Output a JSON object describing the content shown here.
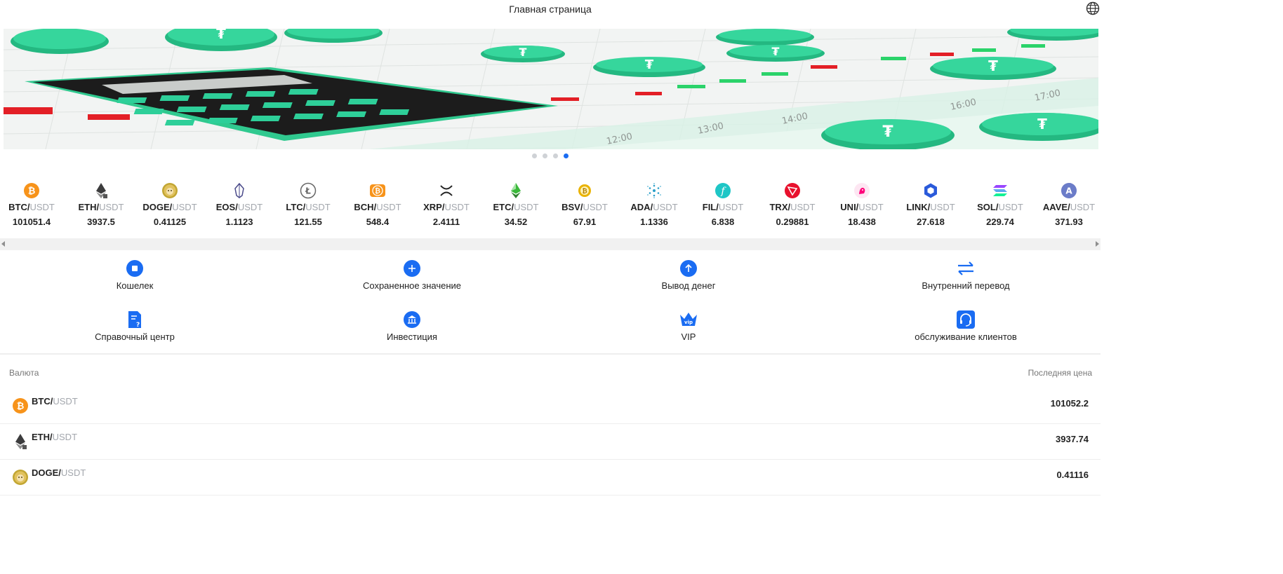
{
  "header": {
    "title": "Главная страница",
    "language_icon": "globe-icon"
  },
  "banner": {
    "slides": 4,
    "active_slide": 4
  },
  "ticker": [
    {
      "base": "BTC/",
      "quote": "USDT",
      "price": "101051.4",
      "icon": "btc-icon"
    },
    {
      "base": "ETH/",
      "quote": "USDT",
      "price": "3937.5",
      "icon": "eth-icon"
    },
    {
      "base": "DOGE/",
      "quote": "USDT",
      "price": "0.41125",
      "icon": "doge-icon"
    },
    {
      "base": "EOS/",
      "quote": "USDT",
      "price": "1.1123",
      "icon": "eos-icon"
    },
    {
      "base": "LTC/",
      "quote": "USDT",
      "price": "121.55",
      "icon": "ltc-icon"
    },
    {
      "base": "BCH/",
      "quote": "USDT",
      "price": "548.4",
      "icon": "bch-icon"
    },
    {
      "base": "XRP/",
      "quote": "USDT",
      "price": "2.4111",
      "icon": "xrp-icon"
    },
    {
      "base": "ETC/",
      "quote": "USDT",
      "price": "34.52",
      "icon": "etc-icon"
    },
    {
      "base": "BSV/",
      "quote": "USDT",
      "price": "67.91",
      "icon": "bsv-icon"
    },
    {
      "base": "ADA/",
      "quote": "USDT",
      "price": "1.1336",
      "icon": "ada-icon"
    },
    {
      "base": "FIL/",
      "quote": "USDT",
      "price": "6.838",
      "icon": "fil-icon"
    },
    {
      "base": "TRX/",
      "quote": "USDT",
      "price": "0.29881",
      "icon": "trx-icon"
    },
    {
      "base": "UNI/",
      "quote": "USDT",
      "price": "18.438",
      "icon": "uni-icon"
    },
    {
      "base": "LINK/",
      "quote": "USDT",
      "price": "27.618",
      "icon": "link-icon"
    },
    {
      "base": "SOL/",
      "quote": "USDT",
      "price": "229.74",
      "icon": "sol-icon"
    },
    {
      "base": "AAVE/",
      "quote": "USDT",
      "price": "371.93",
      "icon": "aave-icon"
    }
  ],
  "actions": [
    {
      "label": "Кошелек",
      "icon": "wallet-icon"
    },
    {
      "label": "Сохраненное значение",
      "icon": "plus-icon"
    },
    {
      "label": "Вывод денег",
      "icon": "withdraw-arrow-icon"
    },
    {
      "label": "Внутренний перевод",
      "icon": "transfer-arrows-icon"
    },
    {
      "label": "Справочный центр",
      "icon": "help-document-icon"
    },
    {
      "label": "Инвестиция",
      "icon": "bank-icon"
    },
    {
      "label": "VIP",
      "icon": "vip-crown-icon"
    },
    {
      "label": "обслуживание клиентов",
      "icon": "headset-icon"
    }
  ],
  "market": {
    "col_currency": "Валюта",
    "col_last_price": "Последняя цена",
    "rows": [
      {
        "base": "BTC/",
        "quote": "USDT",
        "price": "101052.2",
        "icon": "btc-icon"
      },
      {
        "base": "ETH/",
        "quote": "USDT",
        "price": "3937.74",
        "icon": "eth-icon"
      },
      {
        "base": "DOGE/",
        "quote": "USDT",
        "price": "0.41116",
        "icon": "doge-icon"
      }
    ]
  },
  "colors": {
    "accent": "#1a6cf2",
    "muted": "#a3a7ad",
    "banner_green": "#2ed39a"
  }
}
